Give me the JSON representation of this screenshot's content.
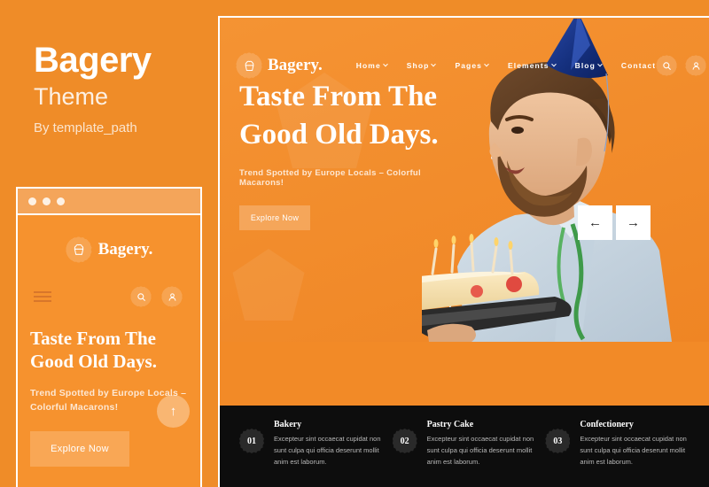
{
  "promo": {
    "title": "Bagery",
    "subtitle": "Theme",
    "author": "By template_path"
  },
  "colors": {
    "brand_orange": "#ef8c28",
    "chrome_orange": "#f4a55a",
    "hero_orange": "#f28a27",
    "dark": "#0d0d0d",
    "white": "#ffffff"
  },
  "desktop": {
    "chrome_dots": [
      "dot-1",
      "dot-2",
      "dot-3"
    ],
    "brand": {
      "logo_icon": "cupcake-badge-icon",
      "name": "Bagery."
    },
    "nav": [
      {
        "label": "Home",
        "has_dropdown": true
      },
      {
        "label": "Shop",
        "has_dropdown": true
      },
      {
        "label": "Pages",
        "has_dropdown": true
      },
      {
        "label": "Elements",
        "has_dropdown": true
      },
      {
        "label": "Blog",
        "has_dropdown": true
      },
      {
        "label": "Contact",
        "has_dropdown": false
      }
    ],
    "actions": [
      {
        "icon": "search-icon",
        "glyph": "⌕"
      },
      {
        "icon": "user-icon",
        "glyph": "⚬"
      }
    ],
    "hero": {
      "heading": "Taste From The Good Old Days.",
      "subheading": "Trend Spotted by Europe Locals – Colorful Macarons!",
      "cta_label": "Explore Now",
      "image_alt": "man-with-party-hat-holding-birthday-cake"
    },
    "carousel": {
      "prev_glyph": "←",
      "next_glyph": "→"
    },
    "features": [
      {
        "number": "01",
        "title": "Bakery",
        "text": "Excepteur sint occaecat cupidat non sunt culpa qui officia deserunt mollit anim est laborum."
      },
      {
        "number": "02",
        "title": "Pastry Cake",
        "text": "Excepteur sint occaecat cupidat non sunt culpa qui officia deserunt mollit anim est laborum."
      },
      {
        "number": "03",
        "title": "Confectionery",
        "text": "Excepteur sint occaecat cupidat non sunt culpa qui officia deserunt mollit anim est laborum."
      }
    ]
  },
  "mobile": {
    "chrome_dots": [
      "dot-1",
      "dot-2",
      "dot-3"
    ],
    "brand": {
      "logo_icon": "cupcake-badge-icon",
      "name": "Bagery."
    },
    "menu_icon": "hamburger-icon",
    "actions": [
      {
        "icon": "search-icon",
        "glyph": "⌕"
      },
      {
        "icon": "user-icon",
        "glyph": "⚬"
      }
    ],
    "hero": {
      "heading": "Taste From The Good Old Days.",
      "subheading": "Trend Spotted by Europe Locals – Colorful Macarons!",
      "cta_label": "Explore Now"
    },
    "scroll_top": {
      "icon": "arrow-up-icon",
      "glyph": "↑"
    }
  }
}
